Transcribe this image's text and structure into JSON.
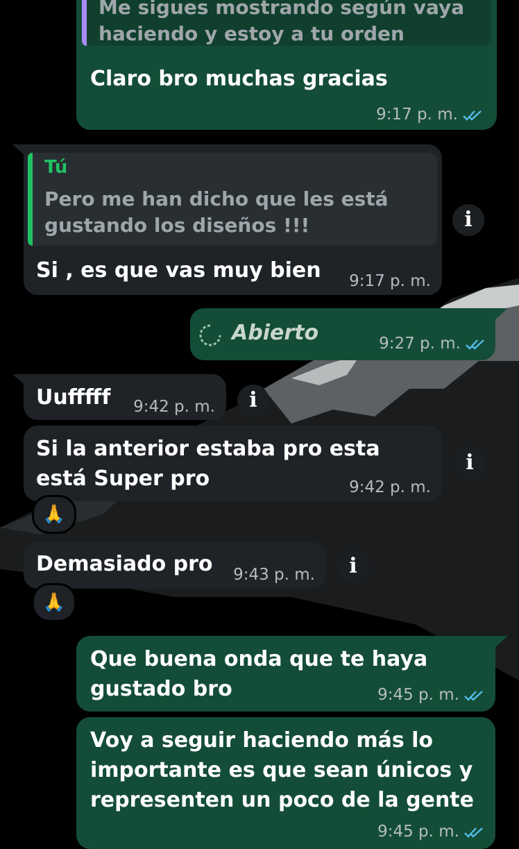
{
  "colors": {
    "outgoing": "#144d37",
    "incoming": "#1f2328",
    "read_ticks": "#53bdeb",
    "quote_author": "#21c063"
  },
  "messages": [
    {
      "id": "m1",
      "direction": "out",
      "quote": {
        "text": "Me sigues mostrando según vaya haciendo y estoy a tu orden"
      },
      "text": "Claro bro muchas gracias",
      "time": "9:17 p. m.",
      "status": "read"
    },
    {
      "id": "m2",
      "direction": "in",
      "quote": {
        "author": "Tú",
        "text": "Pero me han dicho que les está gustando los diseños !!!"
      },
      "text": "Si , es que vas muy bien",
      "time": "9:17 p. m."
    },
    {
      "id": "m3",
      "direction": "out",
      "text": "Abierto",
      "icon": "view-once-icon",
      "time": "9:27 p. m.",
      "status": "read"
    },
    {
      "id": "m4",
      "direction": "in",
      "text": "Uufffff",
      "time": "9:42 p. m."
    },
    {
      "id": "m5",
      "direction": "in",
      "text": "Si la anterior estaba pro esta está Super pro",
      "time": "9:42 p. m.",
      "reaction": "🙏"
    },
    {
      "id": "m6",
      "direction": "in",
      "text": "Demasiado pro",
      "time": "9:43 p. m.",
      "reaction": "🙏"
    },
    {
      "id": "m7",
      "direction": "out",
      "text": "Que buena onda que te haya gustado bro",
      "time": "9:45 p. m.",
      "status": "read"
    },
    {
      "id": "m8",
      "direction": "out",
      "text": "Voy a seguir haciendo más lo importante es que sean únicos y representen un poco de la gente",
      "time": "9:45 p. m.",
      "status": "read"
    }
  ],
  "info_icon": "i"
}
